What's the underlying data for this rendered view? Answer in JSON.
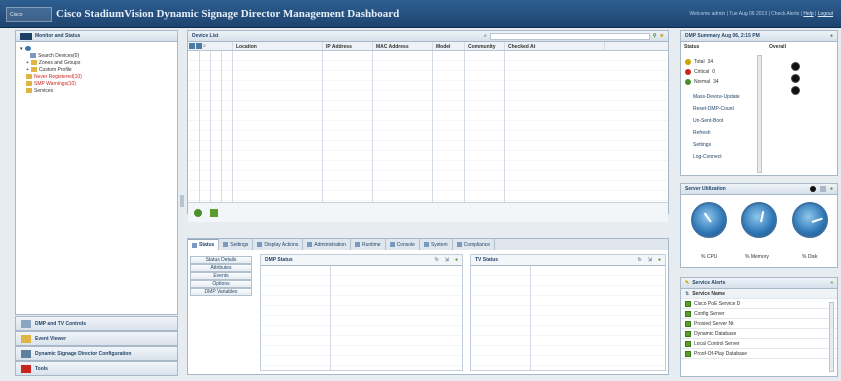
{
  "header": {
    "logo_text": "Cisco",
    "title": "Cisco StadiumVision Dynamic Signage Director Management Dashboard",
    "user_info_prefix": "Welcome admin | Tue Aug 06 2013 | Check Alerts | ",
    "help_link": "Help",
    "logout_link": "Logout"
  },
  "left": {
    "panel_title": "Monitor and Status",
    "tree": [
      {
        "label": "Search Devices(0)",
        "err": false
      },
      {
        "label": "Zones and Groups",
        "err": false
      },
      {
        "label": "Custom Profile",
        "err": false
      },
      {
        "label": "Never Registered(10)",
        "err": true
      },
      {
        "label": "SMP Warnings(10)",
        "err": true
      },
      {
        "label": "Services",
        "err": false
      }
    ],
    "accordions": [
      "DMP and TV Controls",
      "Event Viewer",
      "Dynamic Signage Director Configuration",
      "Tools"
    ]
  },
  "center": {
    "device_list_title": "Device List",
    "columns": [
      "Location",
      "IP Address",
      "MAC Address",
      "Model",
      "Community",
      "Checked At"
    ],
    "tabs": [
      "Status",
      "Settings",
      "Display Actions",
      "Administration",
      "Runtime",
      "Console",
      "System",
      "Compliance"
    ],
    "side_buttons": [
      "Status Details",
      "Attributes",
      "Events",
      "Options",
      "DMP Variables"
    ],
    "dmp_status_title": "DMP Status",
    "tv_status_title": "TV Status"
  },
  "right": {
    "summary_title": "DMP Summary Aug 06, 2:15 PM",
    "status_header": "Status",
    "overall_header": "Overall",
    "counts": [
      {
        "label": "Total",
        "value": "34",
        "color": "#c9a500"
      },
      {
        "label": "Critical",
        "value": "0",
        "color": "#c8261c"
      },
      {
        "label": "Normal",
        "value": "34",
        "color": "#4a8f2a"
      }
    ],
    "summary_buttons": [
      "Mass-Device-Update",
      "Reset-DMP-Count",
      "Un-Sent-Boot",
      "Refresh",
      "Settings",
      "Log-Connect"
    ],
    "util_title": "Server Utilization",
    "gauges": [
      "% CPU",
      "% Memory",
      "% Disk"
    ],
    "gauge_levels": [
      0.35,
      0.55,
      0.8
    ],
    "alerts_title": "Service Alerts",
    "alerts_column": "Service Name",
    "alerts": [
      "Cisco PoE Service D",
      "Config Server",
      "Proxied Server Nt",
      "Dynamic Database",
      "Local Control Server",
      "Proof-Of-Play Database"
    ]
  }
}
